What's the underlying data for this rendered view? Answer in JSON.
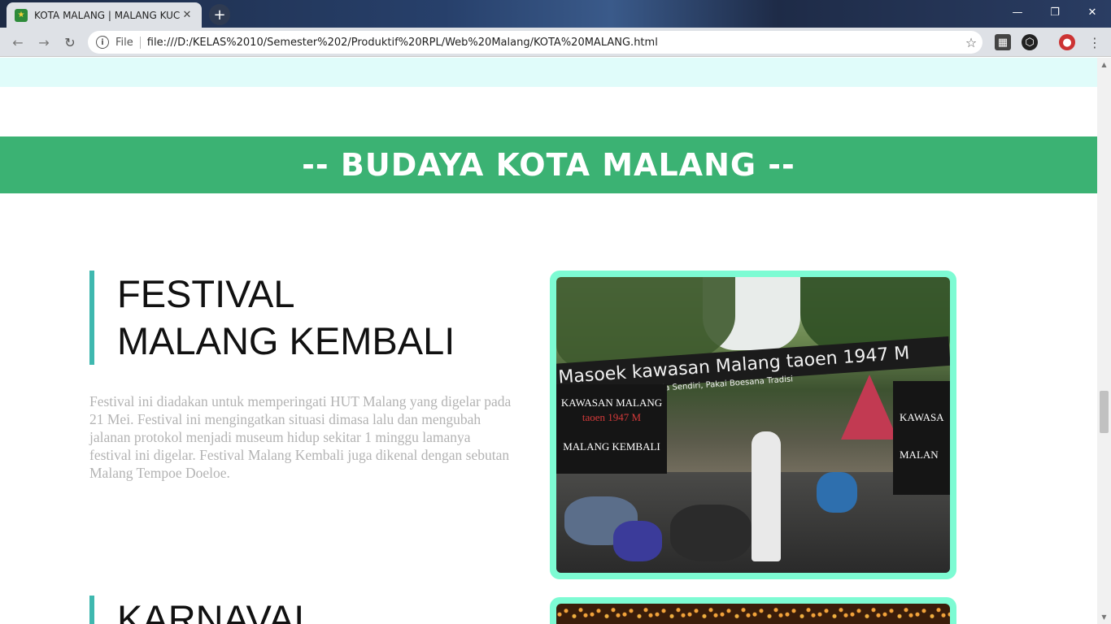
{
  "browser": {
    "tab_title": "KOTA MALANG | MALANG KUCE",
    "tab_close": "✕",
    "new_tab": "+",
    "window_controls": {
      "minimize": "—",
      "restore": "❐",
      "close": "✕"
    },
    "nav": {
      "back": "←",
      "forward": "→",
      "reload": "↻"
    },
    "address_scheme": "File",
    "address_url": "file:///D:/KELAS%2010/Semester%202/Produktif%20RPL/Web%20Malang/KOTA%20MALANG.html",
    "bookmark_icon": "☆"
  },
  "page": {
    "banner_title": "-- BUDAYA KOTA MALANG --",
    "sections": [
      {
        "title_line1": "FESTIVAL",
        "title_line2": "MALANG KEMBALI",
        "description": "Festival ini diadakan untuk memperingati HUT Malang yang digelar pada 21 Mei. Festival ini mengingatkan situasi dimasa lalu dan mengubah jalanan protokol menjadi museum hidup sekitar 1 minggu lamanya festival ini digelar. Festival Malang Kembali juga dikenal dengan sebutan Malang Tempoe Doeloe.",
        "image_banner_text": "Masoek kawasan Malang taoen 1947 M",
        "image_sub_text": "Dengel Boedaja Sendiri, Pakai Boesana Tradisi",
        "image_board_l1": "KAWASAN MALANG",
        "image_board_l2": "taoen 1947 M",
        "image_board_l3": "MALANG KEMBALI",
        "image_board_r1": "KAWASA",
        "image_board_r2": "MALAN"
      },
      {
        "title_line1": "KARNAVAL"
      }
    ]
  },
  "colors": {
    "banner": "#3bb273",
    "heading_accent": "#3fb8af",
    "photo_border": "#7dfbd3",
    "description_text": "#b3b3b3",
    "top_strip": "#e0fcfa"
  }
}
